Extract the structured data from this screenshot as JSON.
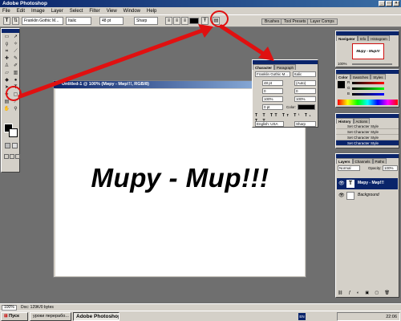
{
  "window": {
    "title": "Adobe Photoshop"
  },
  "menu": [
    "File",
    "Edit",
    "Image",
    "Layer",
    "Select",
    "Filter",
    "View",
    "Window",
    "Help"
  ],
  "options": {
    "tool_letter": "T",
    "font_family": "Franklin Gothic M...",
    "font_style": "Italic",
    "font_size": "48 pt",
    "antialias": "Sharp",
    "palette_tabs": [
      "Brushes",
      "Tool Presets",
      "Layer Comps"
    ]
  },
  "document": {
    "title": "Untitled-1 @ 100% (Миру - Мир!!!, RGB/8)",
    "text": "Миру - Мир!!!"
  },
  "character_palette": {
    "tabs": [
      "Character",
      "Paragraph"
    ],
    "font_family": "Franklin Gothic M...",
    "font_style": "Italic",
    "size": "48 pt",
    "leading": "(Auto)",
    "kerning": "0",
    "tracking": "0",
    "scale_v": "100%",
    "scale_h": "100%",
    "baseline": "0 pt",
    "color_label": "Color:",
    "language": "English: USA",
    "antialias": "Sharp"
  },
  "navigator": {
    "tabs": [
      "Navigator",
      "Info",
      "Histogram"
    ],
    "preview_text": "Миру - Мир!!!",
    "zoom": "100%"
  },
  "color_panel": {
    "tabs": [
      "Color",
      "Swatches",
      "Styles"
    ],
    "channels": [
      "R",
      "G",
      "B"
    ]
  },
  "history_panel": {
    "tabs": [
      "History",
      "Actions"
    ],
    "items": [
      "Set Character Style",
      "Set Character Style",
      "Set Character Style",
      "Set Character Style",
      "Set Character Style"
    ]
  },
  "layers_panel": {
    "tabs": [
      "Layers",
      "Channels",
      "Paths"
    ],
    "blend": "Normal",
    "opacity_label": "Opacity:",
    "opacity": "100%",
    "layers": [
      {
        "name": "Миру - Мир!!!",
        "type": "text",
        "selected": true
      },
      {
        "name": "Background",
        "type": "image",
        "selected": false
      }
    ]
  },
  "status": {
    "zoom": "100%",
    "doc": "Doc: 129K/0 bytes"
  },
  "taskbar": {
    "start": "Пуск",
    "buttons": [
      "уроки перерабо...",
      "Adobe Photoshop"
    ],
    "language": "EN",
    "clock": "22:06"
  },
  "colors": {
    "annotation": "#e01010",
    "title_bar": "#0a246a",
    "workspace": "#6f6f6f"
  }
}
